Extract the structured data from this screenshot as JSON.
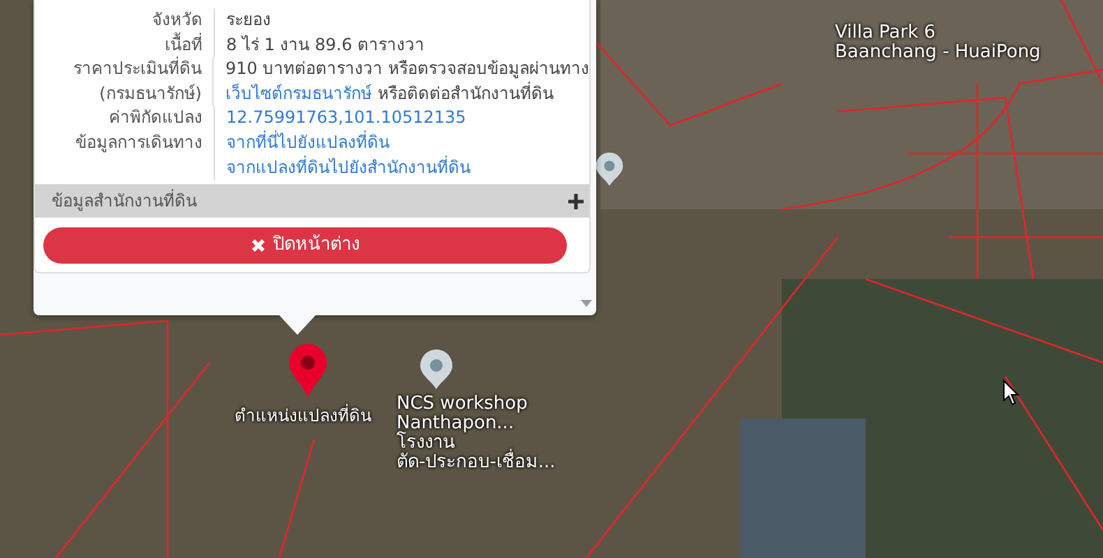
{
  "popup": {
    "rows": [
      {
        "kind": "plain",
        "label_lines": [
          "จังหวัด"
        ],
        "value_lines": [
          [
            {
              "text": "ระยอง",
              "link": false
            }
          ]
        ]
      },
      {
        "kind": "plain",
        "label_lines": [
          "เนื้อที่"
        ],
        "value_lines": [
          [
            {
              "text": "8 ไร่ 1 งาน 89.6 ตารางวา",
              "link": false
            }
          ]
        ]
      },
      {
        "kind": "plain",
        "label_lines": [
          "ราคาประเมินที่ดิน",
          "(กรมธนารักษ์)"
        ],
        "value_lines": [
          [
            {
              "text": "910 บาทต่อตารางวา หรือตรวจสอบข้อมูลผ่านทาง",
              "link": false
            }
          ],
          [
            {
              "text": "เว็บไซต์กรมธนารักษ์",
              "link": true
            },
            {
              "text": "หรือติดต่อสำนักงานที่ดิน",
              "link": false
            }
          ]
        ]
      },
      {
        "kind": "plain",
        "label_lines": [
          "ค่าพิกัดแปลง"
        ],
        "value_lines": [
          [
            {
              "text": "12.75991763,101.10512135",
              "link": true
            }
          ]
        ]
      },
      {
        "kind": "plain",
        "label_lines": [
          "ข้อมูลการเดินทาง"
        ],
        "value_lines": [
          [
            {
              "text": "จากที่นี่ไปยังแปลงที่ดิน",
              "link": true
            }
          ],
          [
            {
              "text": "จากแปลงที่ดินไปยังสำนักงานที่ดิน",
              "link": true
            }
          ]
        ]
      }
    ],
    "section": {
      "title": "ข้อมูลสำนักงานที่ดิน",
      "expanded": false
    },
    "close_button": "ปิดหน้าต่าง"
  },
  "map": {
    "labels": [
      {
        "kind": "place",
        "lines": [
          "Villa Park 6",
          "Baanchang - HuaiPong"
        ]
      },
      {
        "kind": "pin-red",
        "lines": [
          "ตำแหน่งแปลงที่ดิน"
        ]
      },
      {
        "kind": "pin-gray",
        "lines": [
          "NCS workshop",
          "Nanthapon...",
          "โรงงาน",
          "ตัด-ประกอบ-เชื่อม..."
        ]
      }
    ]
  }
}
